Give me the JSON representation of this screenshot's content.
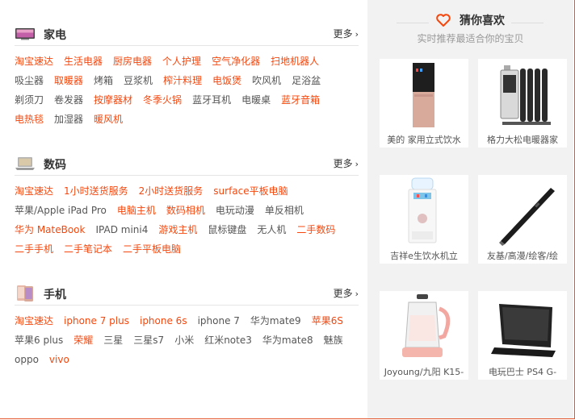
{
  "sections": [
    {
      "title": "家电",
      "more": "更多",
      "links": [
        {
          "t": "淘宝速达",
          "hot": true
        },
        {
          "t": "生活电器",
          "hot": true
        },
        {
          "t": "厨房电器",
          "hot": true
        },
        {
          "t": "个人护理",
          "hot": true
        },
        {
          "t": "空气净化器",
          "hot": true
        },
        {
          "t": "扫地机器人",
          "hot": true
        },
        {
          "t": "吸尘器",
          "hot": false
        },
        {
          "t": "取暖器",
          "hot": true
        },
        {
          "t": "烤箱",
          "hot": false
        },
        {
          "t": "豆浆机",
          "hot": false
        },
        {
          "t": "榨汁料理",
          "hot": true
        },
        {
          "t": "电饭煲",
          "hot": true
        },
        {
          "t": "吹风机",
          "hot": false
        },
        {
          "t": "足浴盆",
          "hot": false
        },
        {
          "t": "剃须刀",
          "hot": false
        },
        {
          "t": "卷发器",
          "hot": false
        },
        {
          "t": "按摩器材",
          "hot": true
        },
        {
          "t": "冬季火锅",
          "hot": true
        },
        {
          "t": "蓝牙耳机",
          "hot": false
        },
        {
          "t": "电暖桌",
          "hot": false
        },
        {
          "t": "蓝牙音箱",
          "hot": true
        },
        {
          "t": "电热毯",
          "hot": true
        },
        {
          "t": "加湿器",
          "hot": false
        },
        {
          "t": "暖风机",
          "hot": true
        }
      ]
    },
    {
      "title": "数码",
      "more": "更多",
      "links": [
        {
          "t": "淘宝速达",
          "hot": true
        },
        {
          "t": "1小时送货服务",
          "hot": true
        },
        {
          "t": "2小时送货服务",
          "hot": true
        },
        {
          "t": "surface平板电脑",
          "hot": true
        },
        {
          "t": "苹果/Apple iPad Pro",
          "hot": false
        },
        {
          "t": "电脑主机",
          "hot": true
        },
        {
          "t": "数码相机",
          "hot": true
        },
        {
          "t": "电玩动漫",
          "hot": false
        },
        {
          "t": "单反相机",
          "hot": false
        },
        {
          "t": "华为 MateBook",
          "hot": true
        },
        {
          "t": "IPAD mini4",
          "hot": false
        },
        {
          "t": "游戏主机",
          "hot": true
        },
        {
          "t": "鼠标键盘",
          "hot": false
        },
        {
          "t": "无人机",
          "hot": false
        },
        {
          "t": "二手数码",
          "hot": true
        },
        {
          "t": "二手手机",
          "hot": true
        },
        {
          "t": "二手笔记本",
          "hot": true
        },
        {
          "t": "二手平板电脑",
          "hot": true
        }
      ]
    },
    {
      "title": "手机",
      "more": "更多",
      "links": [
        {
          "t": "淘宝速达",
          "hot": true
        },
        {
          "t": "iphone 7 plus",
          "hot": true
        },
        {
          "t": "iphone 6s",
          "hot": true
        },
        {
          "t": "iphone 7",
          "hot": false
        },
        {
          "t": "华为mate9",
          "hot": false
        },
        {
          "t": "苹果6S",
          "hot": true
        },
        {
          "t": "苹果6 plus",
          "hot": false
        },
        {
          "t": "荣耀",
          "hot": true
        },
        {
          "t": "三星",
          "hot": false
        },
        {
          "t": "三星s7",
          "hot": false
        },
        {
          "t": "小米",
          "hot": false
        },
        {
          "t": "红米note3",
          "hot": false
        },
        {
          "t": "华为mate8",
          "hot": false
        },
        {
          "t": "魅族",
          "hot": false
        },
        {
          "t": "oppo",
          "hot": false
        },
        {
          "t": "vivo",
          "hot": true
        }
      ]
    }
  ],
  "guess": {
    "title": "猜你喜欢",
    "subtitle": "实时推荐最适合你的宝贝",
    "products": [
      {
        "caption": "美的 家用立式饮水",
        "icon": "water-dispenser-black-icon"
      },
      {
        "caption": "格力大松电暖器家",
        "icon": "oil-heater-icon"
      },
      {
        "caption": "吉祥e生饮水机立",
        "icon": "water-dispenser-white-icon"
      },
      {
        "caption": "友基/高漫/绘客/绘",
        "icon": "stylus-pen-icon"
      },
      {
        "caption": "Joyoung/九阳 K15-",
        "icon": "kettle-icon"
      },
      {
        "caption": "电玩巴士 PS4 G-",
        "icon": "monitor-icon"
      }
    ]
  },
  "colors": {
    "accent": "#f5470d",
    "border": "#e4572e",
    "sidebar_bg": "#f2f2f2"
  }
}
